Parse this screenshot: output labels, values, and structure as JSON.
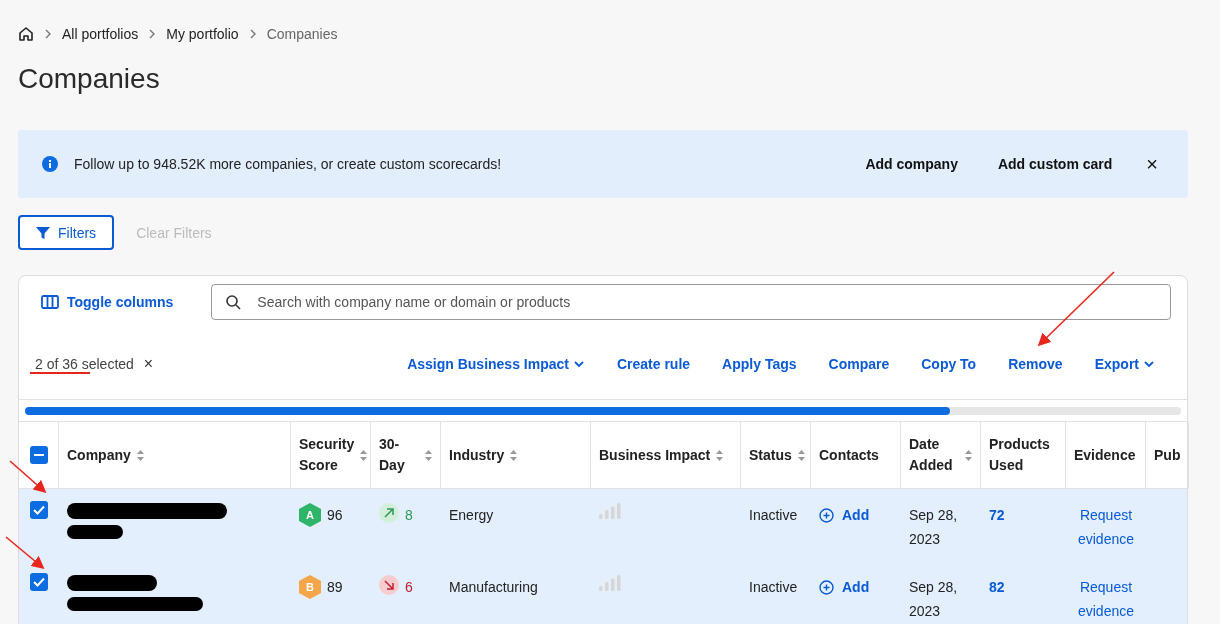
{
  "breadcrumb": {
    "items": [
      "All portfolios",
      "My portfolio",
      "Companies"
    ]
  },
  "page_title": "Companies",
  "banner": {
    "message": "Follow up to 948.52K more companies, or create custom scorecards!",
    "actions": [
      "Add company",
      "Add custom card"
    ],
    "close": "×"
  },
  "filters": {
    "filter_button": "Filters",
    "clear_button": "Clear Filters",
    "clear_disabled": true
  },
  "toolbar": {
    "toggle_columns": "Toggle columns",
    "search": {
      "placeholder": "Search with company name or domain or products"
    }
  },
  "selection": {
    "count_text": "2 of 36 selected",
    "clear": "×"
  },
  "bulk_actions": [
    {
      "label": "Assign Business Impact",
      "dropdown": true
    },
    {
      "label": "Create rule",
      "dropdown": false
    },
    {
      "label": "Apply Tags",
      "dropdown": false
    },
    {
      "label": "Compare",
      "dropdown": false
    },
    {
      "label": "Copy To",
      "dropdown": false
    },
    {
      "label": "Remove",
      "dropdown": false
    },
    {
      "label": "Export",
      "dropdown": true
    }
  ],
  "table": {
    "select_all": {
      "checked": true,
      "partial": true
    },
    "columns": [
      {
        "label": "Company",
        "sortable": true
      },
      {
        "label": "Security Score",
        "sortable": true
      },
      {
        "label": "30-Day",
        "sortable": true
      },
      {
        "label": "Industry",
        "sortable": true
      },
      {
        "label": "Business Impact",
        "sortable": true
      },
      {
        "label": "Status",
        "sortable": true
      },
      {
        "label": "Contacts",
        "sortable": false
      },
      {
        "label": "Date Added",
        "sortable": true
      },
      {
        "label": "Products Used",
        "sortable": false
      },
      {
        "label": "Evidence",
        "sortable": false
      },
      {
        "label": "Pub"
      }
    ],
    "rows": [
      {
        "selected": true,
        "company_redacted": true,
        "grade": "A",
        "color": "#2fb56a",
        "score": "96",
        "trend_up": true,
        "change": "8",
        "industry": "Energy",
        "status": "Inactive",
        "contacts": "Add",
        "date_added": "Sep 28, 2023",
        "products_used": "72",
        "evidence": "Request evidence"
      },
      {
        "selected": true,
        "company_redacted": true,
        "grade": "B",
        "color": "#f5a54a",
        "score": "89",
        "trend_up": false,
        "change": "6",
        "industry": "Manufacturing",
        "status": "Inactive",
        "contacts": "Add",
        "date_added": "Sep 28, 2023",
        "products_used": "82",
        "evidence": "Request evidence"
      }
    ]
  }
}
